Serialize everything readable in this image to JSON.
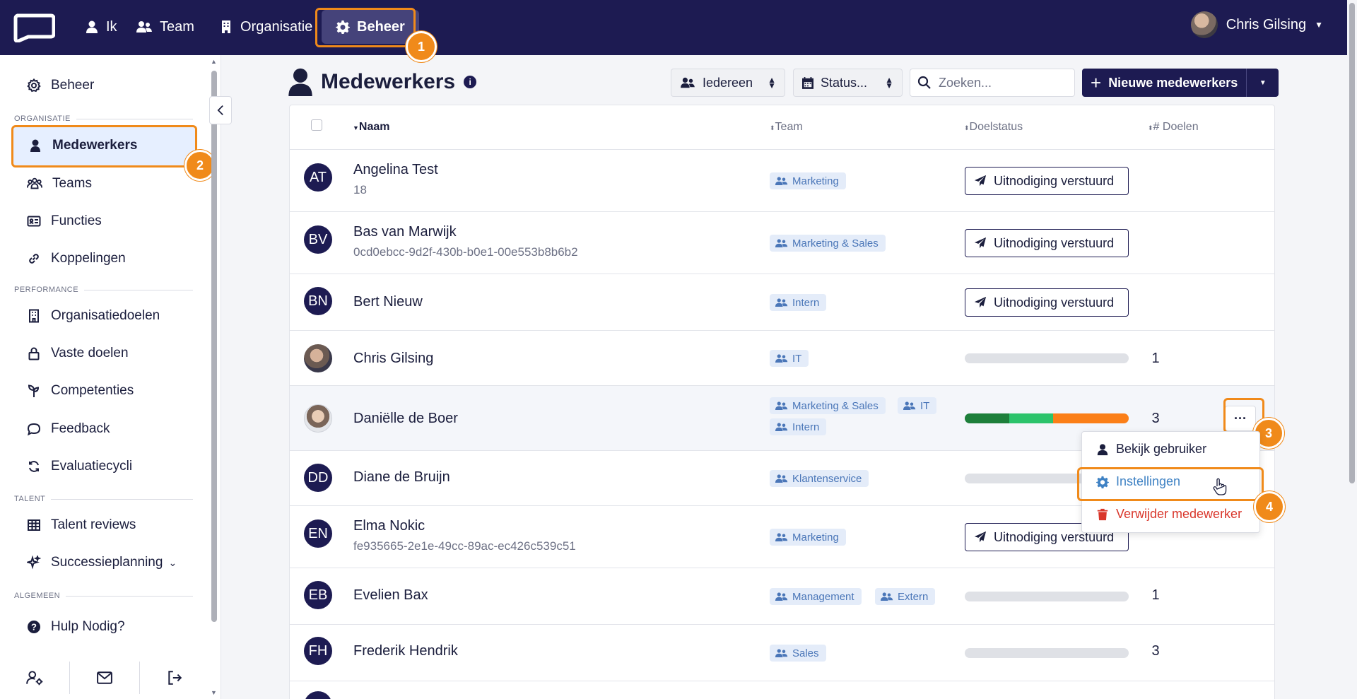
{
  "topnav": {
    "items": [
      {
        "label": "Ik",
        "icon": "user-icon"
      },
      {
        "label": "Team",
        "icon": "users-icon"
      },
      {
        "label": "Organisatie",
        "icon": "building-icon"
      },
      {
        "label": "Beheer",
        "icon": "gear-icon"
      }
    ],
    "user_name": "Chris Gilsing"
  },
  "sidebar": {
    "top_item": "Beheer",
    "sections": [
      {
        "title": "ORGANISATIE",
        "items": [
          "Medewerkers",
          "Teams",
          "Functies",
          "Koppelingen"
        ]
      },
      {
        "title": "PERFORMANCE",
        "items": [
          "Organisatiedoelen",
          "Vaste doelen",
          "Competenties",
          "Feedback",
          "Evaluatiecycli"
        ]
      },
      {
        "title": "TALENT",
        "items": [
          "Talent reviews",
          "Successieplanning"
        ]
      },
      {
        "title": "ALGEMEEN",
        "items": [
          "Hulp Nodig?"
        ]
      }
    ]
  },
  "page": {
    "title": "Medewerkers",
    "filter_people": "Iedereen",
    "filter_status": "Status...",
    "search_placeholder": "Zoeken...",
    "new_button": "Nieuwe medewerkers"
  },
  "table": {
    "columns": [
      "Naam",
      "Team",
      "Doelstatus",
      "# Doelen"
    ],
    "rows": [
      {
        "initials": "AT",
        "name": "Angelina Test",
        "sub": "18",
        "teams": [
          "Marketing"
        ],
        "status": "Uitnodiging verstuurd",
        "count": ""
      },
      {
        "initials": "BV",
        "name": "Bas van Marwijk",
        "sub": "0cd0ebcc-9d2f-430b-b0e1-00e553b8b6b2",
        "teams": [
          "Marketing & Sales"
        ],
        "status": "Uitnodiging verstuurd",
        "count": ""
      },
      {
        "initials": "BN",
        "name": "Bert Nieuw",
        "sub": "",
        "teams": [
          "Intern"
        ],
        "status": "Uitnodiging verstuurd",
        "count": ""
      },
      {
        "initials": "",
        "name": "Chris Gilsing",
        "sub": "",
        "teams": [
          "IT"
        ],
        "status": "",
        "count": "1"
      },
      {
        "initials": "",
        "name": "Daniëlle de Boer",
        "sub": "",
        "teams": [
          "Marketing & Sales",
          "IT",
          "Intern"
        ],
        "status": "",
        "count": "3",
        "progress": {
          "dark_green": 0.27,
          "green": 0.27,
          "orange": 0.46
        }
      },
      {
        "initials": "DD",
        "name": "Diane de Bruijn",
        "sub": "",
        "teams": [
          "Klantenservice"
        ],
        "status": "",
        "count": ""
      },
      {
        "initials": "EN",
        "name": "Elma Nokic",
        "sub": "fe935665-2e1e-49cc-89ac-ec426c539c51",
        "teams": [
          "Marketing"
        ],
        "status": "Uitnodiging verstuurd",
        "count": ""
      },
      {
        "initials": "EB",
        "name": "Evelien Bax",
        "sub": "",
        "teams": [
          "Management",
          "Extern"
        ],
        "status": "",
        "count": "1"
      },
      {
        "initials": "FH",
        "name": "Frederik Hendrik",
        "sub": "",
        "teams": [
          "Sales"
        ],
        "status": "",
        "count": "3"
      }
    ]
  },
  "dropdown": {
    "items": [
      {
        "label": "Bekijk gebruiker",
        "icon": "user-icon"
      },
      {
        "label": "Instellingen",
        "icon": "gear-icon"
      },
      {
        "label": "Verwijder medewerker",
        "icon": "trash-icon"
      }
    ]
  },
  "step_badges": [
    "1",
    "2",
    "3",
    "4"
  ],
  "colors": {
    "nav_bg": "#1d1b52",
    "highlight": "#f08a1a",
    "tag_bg": "#e4ecf9",
    "tag_text": "#4a76b8",
    "danger": "#d9362b",
    "settings_blue": "#3f82c4",
    "progress_dark_green": "#1d7f3a",
    "progress_green": "#2cc36b",
    "progress_orange": "#fb7f18"
  }
}
